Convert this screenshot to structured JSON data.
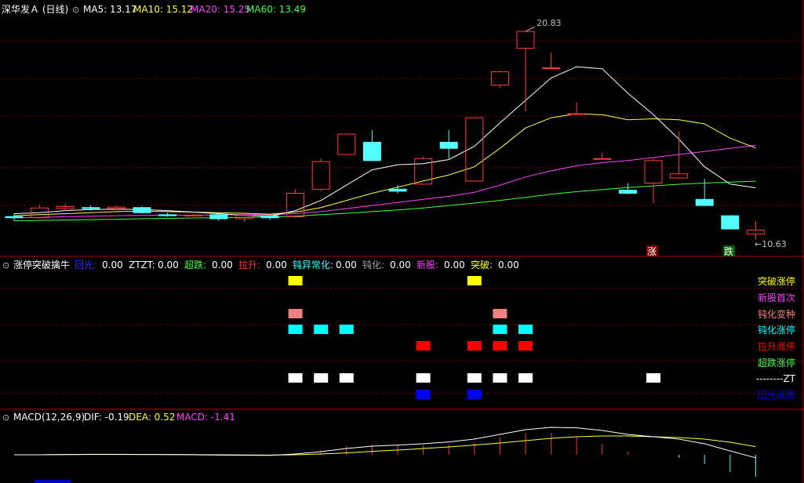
{
  "stock": {
    "title": "深华发Ａ (日线)",
    "ma": [
      {
        "label": "MA5: 13.17",
        "color": "#ffffff"
      },
      {
        "label": "MA10: 15.12",
        "color": "#ffff40"
      },
      {
        "label": "MA20: 15.25",
        "color": "#ff40ff"
      },
      {
        "label": "MA60: 13.49",
        "color": "#40ff40"
      }
    ],
    "high_label": "20.83",
    "low_label": "←10.63",
    "badge_up": "涨",
    "badge_down": "跌"
  },
  "signal_panel": {
    "title": "涨停突破擒牛",
    "stats": [
      {
        "label": "回光:",
        "value": "0.00",
        "color": "#3030ff"
      },
      {
        "label": "ZTZT:",
        "value": "0.00",
        "color": "#ffffff"
      },
      {
        "label": "超跌:",
        "value": "0.00",
        "color": "#40ff40"
      },
      {
        "label": "拉升:",
        "value": "0.00",
        "color": "#ff3030"
      },
      {
        "label": "钝异常化:",
        "value": "0.00",
        "color": "#40ffff"
      },
      {
        "label": "钝化:",
        "value": "0.00",
        "color": "#a0a0a0"
      },
      {
        "label": "新股:",
        "value": "0.00",
        "color": "#ff40ff"
      },
      {
        "label": "突破:",
        "value": "0.00",
        "color": "#ffff40"
      }
    ],
    "rows": [
      {
        "label": "突破涨停",
        "color": "#ffff00",
        "bars": [
          11,
          18
        ]
      },
      {
        "label": "新股首次",
        "color": "#ff40ff",
        "bars": []
      },
      {
        "label": "钝化变种",
        "color": "#f08080",
        "bars": [
          11,
          19
        ]
      },
      {
        "label": "钝化涨停",
        "color": "#00ffff",
        "bars": [
          11,
          12,
          13,
          19,
          20
        ]
      },
      {
        "label": "拉升涨停",
        "color": "#ff0000",
        "bars": [
          16,
          18,
          19,
          20
        ]
      },
      {
        "label": "超跌涨停",
        "color": "#40ff40",
        "bars": []
      },
      {
        "label": "--------ZT",
        "color": "#ffffff",
        "bars": [
          11,
          12,
          13,
          16,
          18,
          19,
          20,
          25
        ]
      },
      {
        "label": "回光返照",
        "color": "#0000ff",
        "bars": [
          16,
          18
        ]
      }
    ]
  },
  "macd_panel": {
    "title": "MACD(12,26,9)",
    "dif": "DIF: -0.19",
    "dea": "DEA: 0.52",
    "macd": "MACD: -1.41"
  },
  "chart_data": {
    "type": "candlestick",
    "price_range": [
      10.0,
      21.6
    ],
    "candles": [
      {
        "o": 11.76,
        "h": 11.9,
        "l": 11.55,
        "c": 11.7
      },
      {
        "o": 11.7,
        "h": 12.3,
        "l": 11.65,
        "c": 12.18
      },
      {
        "o": 12.15,
        "h": 12.4,
        "l": 12.05,
        "c": 12.25
      },
      {
        "o": 12.2,
        "h": 12.3,
        "l": 12.05,
        "c": 12.15
      },
      {
        "o": 12.15,
        "h": 12.3,
        "l": 12.1,
        "c": 12.22
      },
      {
        "o": 12.2,
        "h": 12.25,
        "l": 11.9,
        "c": 11.95
      },
      {
        "o": 11.85,
        "h": 11.95,
        "l": 11.75,
        "c": 11.8
      },
      {
        "o": 11.8,
        "h": 11.9,
        "l": 11.78,
        "c": 11.83
      },
      {
        "o": 11.85,
        "h": 11.9,
        "l": 11.55,
        "c": 11.65
      },
      {
        "o": 11.65,
        "h": 11.9,
        "l": 11.5,
        "c": 11.82
      },
      {
        "o": 11.8,
        "h": 11.85,
        "l": 11.6,
        "c": 11.7
      },
      {
        "o": 11.75,
        "h": 13.1,
        "l": 11.7,
        "c": 12.9
      },
      {
        "o": 13.1,
        "h": 14.6,
        "l": 13.0,
        "c": 14.45
      },
      {
        "o": 14.8,
        "h": 15.8,
        "l": 14.8,
        "c": 15.8
      },
      {
        "o": 15.4,
        "h": 16.0,
        "l": 14.5,
        "c": 14.5
      },
      {
        "o": 13.1,
        "h": 13.3,
        "l": 12.9,
        "c": 13.0
      },
      {
        "o": 13.35,
        "h": 14.7,
        "l": 13.3,
        "c": 14.6
      },
      {
        "o": 15.4,
        "h": 16.0,
        "l": 14.6,
        "c": 15.1
      },
      {
        "o": 13.5,
        "h": 16.6,
        "l": 13.5,
        "c": 16.6
      },
      {
        "o": 18.2,
        "h": 18.9,
        "l": 18.05,
        "c": 18.85
      },
      {
        "o": 20.0,
        "h": 20.83,
        "l": 16.9,
        "c": 20.83
      },
      {
        "o": 19.05,
        "h": 19.8,
        "l": 19.05,
        "c": 19.05
      },
      {
        "o": 16.8,
        "h": 17.35,
        "l": 16.8,
        "c": 16.8
      },
      {
        "o": 14.6,
        "h": 14.9,
        "l": 14.6,
        "c": 14.6
      },
      {
        "o": 13.05,
        "h": 13.4,
        "l": 12.85,
        "c": 12.9
      },
      {
        "o": 13.4,
        "h": 14.6,
        "l": 12.4,
        "c": 14.5
      },
      {
        "o": 13.65,
        "h": 15.95,
        "l": 13.6,
        "c": 13.85
      },
      {
        "o": 12.6,
        "h": 13.6,
        "l": 12.3,
        "c": 12.3
      },
      {
        "o": 11.8,
        "h": 11.8,
        "l": 11.15,
        "c": 11.15
      },
      {
        "o": 10.9,
        "h": 11.55,
        "l": 10.63,
        "c": 11.1
      }
    ],
    "ma5": [
      11.9,
      11.95,
      12.05,
      12.1,
      12.12,
      12.1,
      12.05,
      11.98,
      11.9,
      11.82,
      11.78,
      12.05,
      12.55,
      13.3,
      14.05,
      14.3,
      14.35,
      14.55,
      15.2,
      16.35,
      17.45,
      18.55,
      19.1,
      19.0,
      17.8,
      16.75,
      15.55,
      14.2,
      13.35,
      13.17
    ],
    "ma10": [
      11.8,
      11.85,
      11.9,
      11.95,
      12.0,
      12.02,
      12.0,
      11.98,
      11.95,
      11.92,
      11.88,
      11.98,
      12.2,
      12.55,
      12.9,
      13.2,
      13.5,
      13.8,
      14.2,
      15.1,
      16.1,
      16.6,
      16.8,
      16.75,
      16.5,
      16.55,
      16.5,
      16.3,
      15.6,
      15.12
    ],
    "ma20": [
      11.7,
      11.72,
      11.75,
      11.78,
      11.8,
      11.82,
      11.83,
      11.83,
      11.84,
      11.85,
      11.85,
      11.9,
      12.0,
      12.15,
      12.3,
      12.45,
      12.6,
      12.75,
      12.95,
      13.3,
      13.7,
      14.0,
      14.25,
      14.4,
      14.5,
      14.65,
      14.8,
      14.95,
      15.1,
      15.25
    ],
    "ma60": [
      11.55,
      11.57,
      11.59,
      11.61,
      11.63,
      11.65,
      11.67,
      11.69,
      11.7,
      11.72,
      11.74,
      11.78,
      11.85,
      11.92,
      12.0,
      12.08,
      12.18,
      12.3,
      12.42,
      12.55,
      12.7,
      12.85,
      12.98,
      13.08,
      13.18,
      13.26,
      13.34,
      13.4,
      13.45,
      13.49
    ],
    "macd_range": [
      -2.0,
      2.0
    ],
    "dif": [
      0.0,
      0.0,
      0.02,
      0.03,
      0.03,
      0.02,
      0.01,
      0.0,
      -0.02,
      -0.03,
      -0.04,
      0.05,
      0.2,
      0.4,
      0.55,
      0.62,
      0.7,
      0.82,
      1.0,
      1.3,
      1.6,
      1.75,
      1.72,
      1.55,
      1.3,
      1.15,
      1.0,
      0.7,
      0.25,
      -0.19
    ],
    "dea": [
      0.0,
      0.0,
      0.01,
      0.02,
      0.02,
      0.02,
      0.02,
      0.01,
      0.0,
      -0.01,
      -0.02,
      0.0,
      0.05,
      0.12,
      0.22,
      0.3,
      0.4,
      0.5,
      0.62,
      0.75,
      0.9,
      1.05,
      1.15,
      1.2,
      1.2,
      1.15,
      1.1,
      1.0,
      0.8,
      0.52
    ],
    "macd": [
      0.0,
      0.0,
      0.02,
      0.02,
      0.02,
      0.0,
      -0.02,
      -0.02,
      -0.04,
      -0.04,
      -0.04,
      0.1,
      0.3,
      0.56,
      0.66,
      0.64,
      0.6,
      0.64,
      0.76,
      1.1,
      1.4,
      1.4,
      1.14,
      0.7,
      0.2,
      0.0,
      -0.2,
      -0.6,
      -1.1,
      -1.41
    ]
  }
}
